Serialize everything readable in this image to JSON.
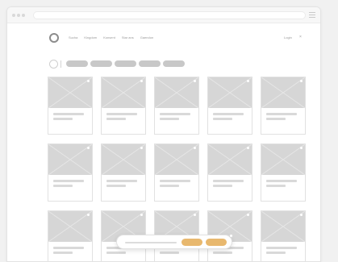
{
  "colors": {
    "accent": "#e8b86e",
    "placeholder_gray": "#d6d6d6",
    "pill_gray": "#c8c8c8"
  },
  "header": {
    "nav_items": [
      "Sucha",
      "Kingdom",
      "Konsent",
      "Star ans",
      "Gaendon"
    ],
    "login_label": "Login",
    "search_icon": "×"
  },
  "filters": {
    "pill_count": 5
  },
  "grid": {
    "rows": 3,
    "columns": 5
  },
  "bottom_bar": {
    "accent_buttons": 2
  }
}
